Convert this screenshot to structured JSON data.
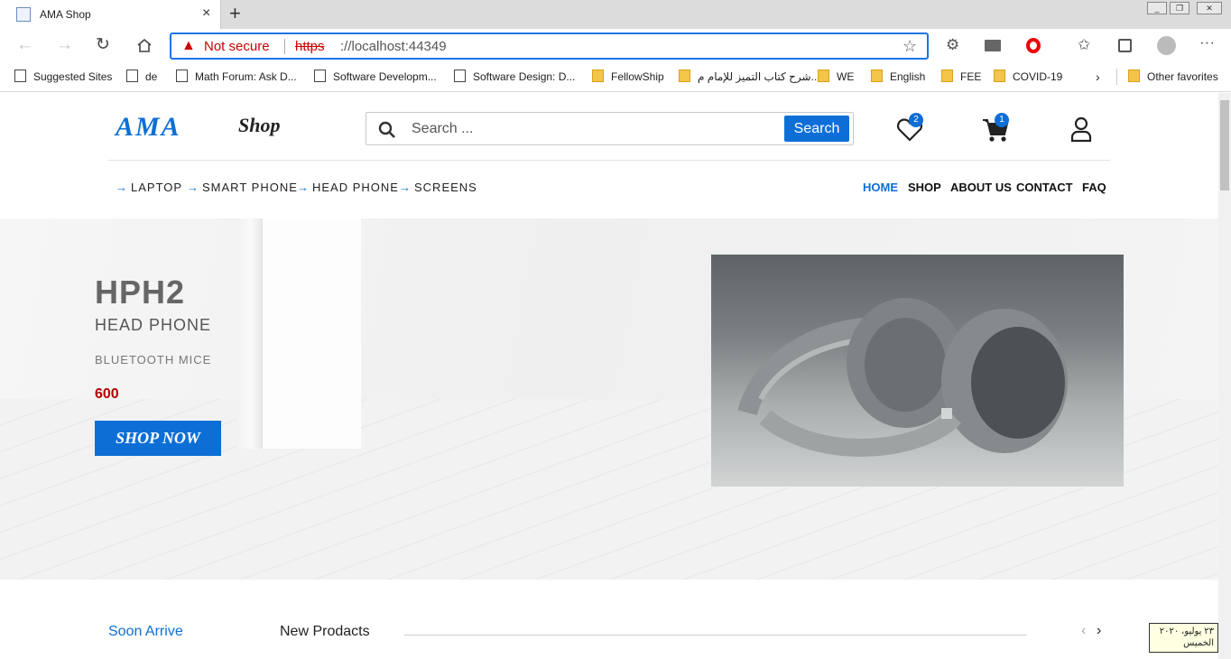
{
  "browser": {
    "tab_title": "AMA Shop",
    "tab_close": "×",
    "new_tab": "+",
    "not_secure": "Not secure",
    "url_protocol": "https",
    "url_rest": "://localhost:44349",
    "icons": {
      "back": "back-icon",
      "forward": "forward-icon",
      "refresh": "refresh-icon",
      "home": "home-icon",
      "favorite": "star-icon",
      "favorites": "favorites-icon",
      "collections": "collections-icon",
      "profile": "profile-icon",
      "more": "more-icon"
    }
  },
  "bookmarks": [
    {
      "label": "Suggested Sites",
      "type": "file"
    },
    {
      "label": "de",
      "type": "file"
    },
    {
      "label": "Math Forum: Ask D...",
      "type": "file"
    },
    {
      "label": "Software Developm...",
      "type": "file"
    },
    {
      "label": "Software Design: D...",
      "type": "file"
    },
    {
      "label": "FellowShip",
      "type": "folder"
    },
    {
      "label": "شرح كتاب التميز للإمام م...",
      "type": "folder"
    },
    {
      "label": "WE",
      "type": "folder"
    },
    {
      "label": "English",
      "type": "folder"
    },
    {
      "label": "FEE",
      "type": "folder"
    },
    {
      "label": "COVID-19",
      "type": "folder"
    },
    {
      "label": "Other favorites",
      "type": "folder"
    }
  ],
  "header": {
    "logo_main": "AMA",
    "logo_sub": "Shop",
    "search_placeholder": "Search ...",
    "search_button": "Search",
    "wishlist_count": "2",
    "cart_count": "1"
  },
  "categories": [
    "LAPTOP",
    "SMART PHONE",
    "HEAD PHONE",
    "SCREENS"
  ],
  "menu": [
    {
      "label": "HOME",
      "active": true
    },
    {
      "label": "SHOP",
      "active": false
    },
    {
      "label": "ABOUT US",
      "active": false
    },
    {
      "label": "CONTACT",
      "active": false
    },
    {
      "label": "FAQ",
      "active": false
    }
  ],
  "hero": {
    "title": "HPH2",
    "subtitle": "HEAD PHONE",
    "tagline": "BLUETOOTH MICE",
    "price": "600",
    "cta": "SHOP NOW"
  },
  "products": {
    "tab_active": "Soon Arrive",
    "tab_title": "New Prodacts",
    "prev": "‹",
    "next": "›"
  },
  "taskbar_tooltip": {
    "line1": "٢٣ يوليو، ٢٠٢٠",
    "line2": "الخميس"
  },
  "colors": {
    "brand": "#0d6fd6",
    "price": "#b30000",
    "warning": "#cc0000"
  }
}
